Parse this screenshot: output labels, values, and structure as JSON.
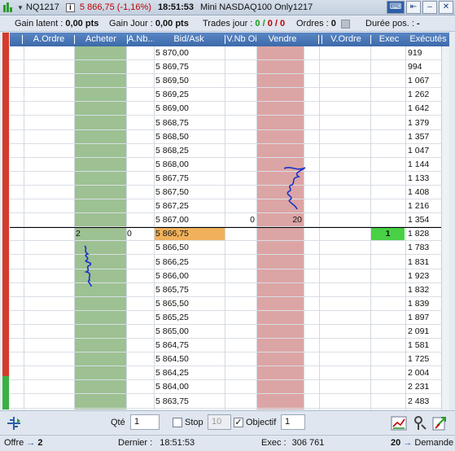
{
  "titlebar": {
    "symbol": "NQ1217",
    "info": "i",
    "price": "5 866,75 (-1,16%)",
    "time": "18:51:53",
    "name": "Mini NASDAQ100 Only1217",
    "kb": "⌨",
    "pin": "⇤",
    "min": "–",
    "close": "✕"
  },
  "stats": {
    "gain_latent_label": "Gain latent :",
    "gain_latent_value": "0,00 pts",
    "gain_jour_label": "Gain Jour :",
    "gain_jour_value": "0,00 pts",
    "trades_label": "Trades jour :",
    "trades_a": "0",
    "trades_sep1": "/",
    "trades_b": "0",
    "trades_sep2": "/",
    "trades_c": "0",
    "ordres_label": "Ordres :",
    "ordres_value": "0",
    "duree_label": "Durée pos. :",
    "duree_value": "-"
  },
  "columns": {
    "a_ordre": "A.Ordre",
    "acheter": "Acheter",
    "a_nb": "A.Nb...",
    "bid_ask": "Bid/Ask",
    "v_nb": "V.Nb Oi",
    "vendre": "Vendre",
    "v_ordre": "V.Ordre",
    "exec": "Exec",
    "executes": "Exécutés"
  },
  "rows": [
    {
      "price": "5 870,00",
      "executes": "919"
    },
    {
      "price": "5 869,75",
      "executes": "994"
    },
    {
      "price": "5 869,50",
      "executes": "1 067"
    },
    {
      "price": "5 869,25",
      "executes": "1 262"
    },
    {
      "price": "5 869,00",
      "executes": "1 642"
    },
    {
      "price": "5 868,75",
      "executes": "1 379"
    },
    {
      "price": "5 868,50",
      "executes": "1 357"
    },
    {
      "price": "5 868,25",
      "executes": "1 047"
    },
    {
      "price": "5 868,00",
      "executes": "1 144"
    },
    {
      "price": "5 867,75",
      "executes": "1 133"
    },
    {
      "price": "5 867,50",
      "executes": "1 408"
    },
    {
      "price": "5 867,25",
      "executes": "1 216"
    },
    {
      "price": "5 867,00",
      "executes": "1 354",
      "v_nb": "0",
      "vendre": "20"
    },
    {
      "price": "5 866,75",
      "executes": "1 828",
      "acheter": "2",
      "a_nb": "0",
      "exec": "1",
      "current": true
    },
    {
      "price": "5 866,50",
      "executes": "1 783"
    },
    {
      "price": "5 866,25",
      "executes": "1 831"
    },
    {
      "price": "5 866,00",
      "executes": "1 923"
    },
    {
      "price": "5 865,75",
      "executes": "1 832"
    },
    {
      "price": "5 865,50",
      "executes": "1 839"
    },
    {
      "price": "5 865,25",
      "executes": "1 897"
    },
    {
      "price": "5 865,00",
      "executes": "2 091"
    },
    {
      "price": "5 864,75",
      "executes": "1 581"
    },
    {
      "price": "5 864,50",
      "executes": "1 725"
    },
    {
      "price": "5 864,25",
      "executes": "2 004"
    },
    {
      "price": "5 864,00",
      "executes": "2 231"
    },
    {
      "price": "5 863,75",
      "executes": "2 483"
    }
  ],
  "toolbar": {
    "qte_label": "Qté",
    "qte_value": "1",
    "stop_label": "Stop",
    "stop_value": "10",
    "objectif_label": "Objectif",
    "objectif_value": "1",
    "objectif_check": "✓"
  },
  "footer": {
    "offre_label": "Offre",
    "offre_arrow": "→",
    "offre_value": "2",
    "dernier_label": "Dernier :",
    "dernier_value": "18:51:53",
    "exec_label": "Exec :",
    "exec_value": "306 761",
    "demande_value": "20",
    "demande_arrow": "→",
    "demande_label": "Demande"
  },
  "colors": {
    "buy_column": "#9dc192",
    "sell_column": "#dca5a5",
    "current_price_bg": "#f1b15c",
    "exec_cell_bg": "#49d146",
    "header_bg": "#4a78b8",
    "price_down": "#c00000"
  }
}
